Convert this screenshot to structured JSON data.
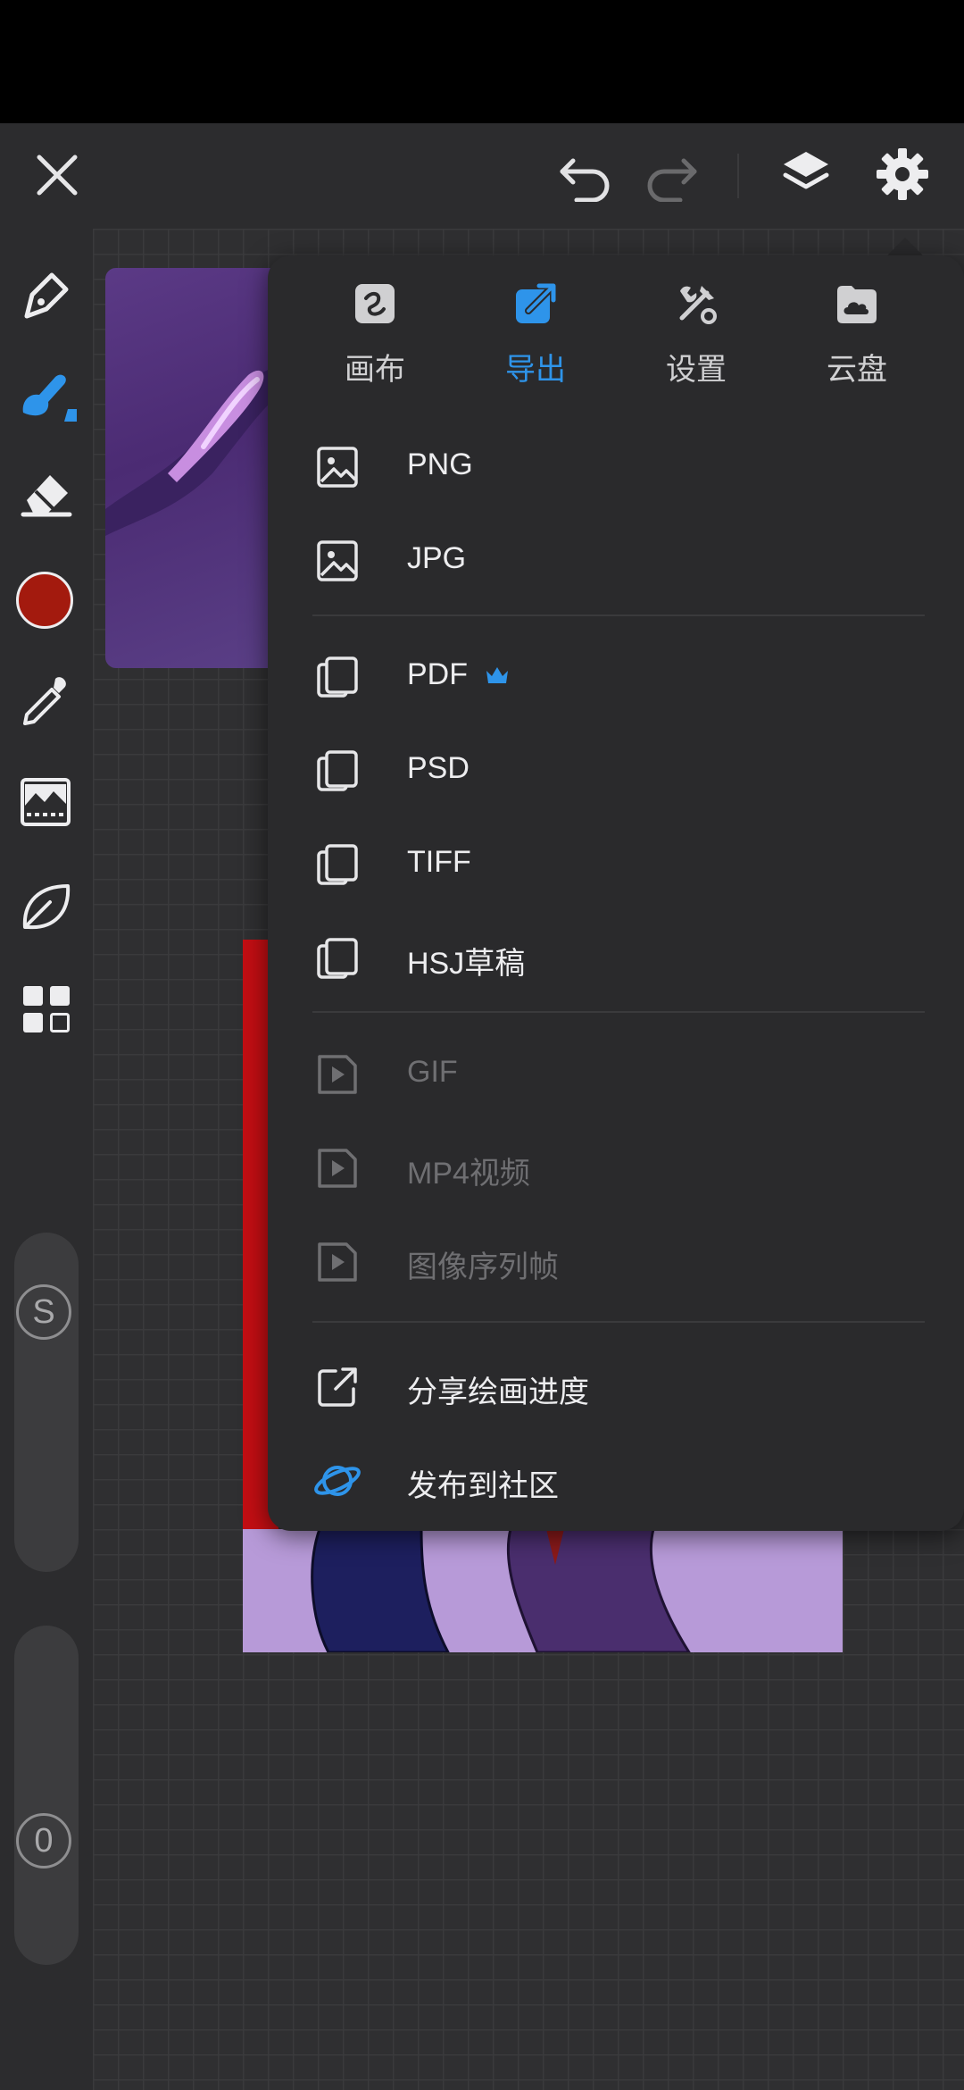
{
  "app": {
    "accent_color": "#2e94ea",
    "brush_color": "#a31a0e"
  },
  "topbar": {
    "close_icon": "close-icon",
    "undo_icon": "undo-icon",
    "redo_icon": "redo-icon",
    "layers_icon": "layers-icon",
    "settings_icon": "gear-icon"
  },
  "sidebar": {
    "tools": [
      "pen-tool-icon",
      "brush-tool-icon",
      "eraser-icon",
      "color-swatch",
      "eyedropper-icon",
      "image-adjust-icon",
      "leaf-icon",
      "grid-apps-icon"
    ],
    "size_slider_label": "S",
    "opacity_slider_label": "0"
  },
  "panel": {
    "tabs": [
      {
        "label": "画布",
        "icon": "canvas-icon",
        "active": false
      },
      {
        "label": "导出",
        "icon": "export-icon",
        "active": true
      },
      {
        "label": "设置",
        "icon": "tools-icon",
        "active": false
      },
      {
        "label": "云盘",
        "icon": "cloud-folder-icon",
        "active": false
      }
    ],
    "image_exports": [
      {
        "label": "PNG",
        "icon": "image-icon"
      },
      {
        "label": "JPG",
        "icon": "image-icon"
      }
    ],
    "document_exports": [
      {
        "label": "PDF",
        "icon": "copy-icon",
        "premium": true
      },
      {
        "label": "PSD",
        "icon": "copy-icon"
      },
      {
        "label": "TIFF",
        "icon": "copy-icon"
      },
      {
        "label": "HSJ草稿",
        "icon": "copy-icon"
      }
    ],
    "video_exports": [
      {
        "label": "GIF",
        "icon": "play-icon",
        "disabled": true
      },
      {
        "label": "MP4视频",
        "icon": "play-icon",
        "disabled": true
      },
      {
        "label": "图像序列帧",
        "icon": "play-icon",
        "disabled": true
      }
    ],
    "share_actions": [
      {
        "label": "分享绘画进度",
        "icon": "share-icon"
      },
      {
        "label": "发布到社区",
        "icon": "planet-icon"
      }
    ]
  }
}
